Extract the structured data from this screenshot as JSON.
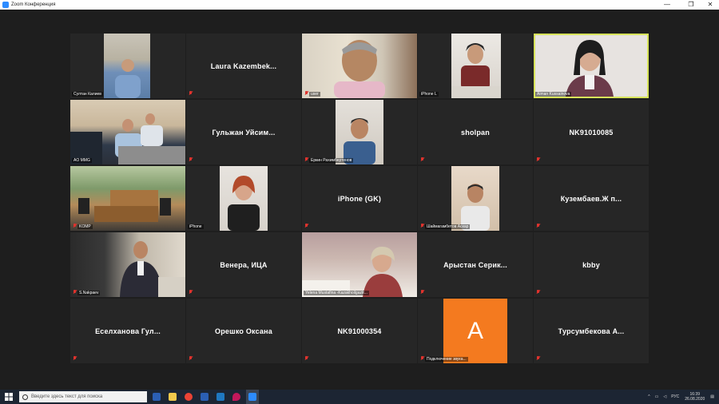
{
  "window": {
    "title": "Zoom Конференция",
    "controls": {
      "minimize": "—",
      "maximize": "❐",
      "close": "✕"
    }
  },
  "tiles": [
    {
      "name": "Султан Калиев",
      "type": "video",
      "muted": false
    },
    {
      "name": "Laura  Kazembek...",
      "type": "name",
      "muted": true
    },
    {
      "name": "user",
      "type": "video",
      "muted": true
    },
    {
      "name": "iPhone L",
      "type": "video",
      "muted": false
    },
    {
      "name": "Aiman Kussainova",
      "type": "video",
      "muted": false,
      "active": true
    },
    {
      "name": "AO MMG",
      "type": "video",
      "muted": false
    },
    {
      "name": "Гульжан  Уйсим...",
      "type": "name",
      "muted": true
    },
    {
      "name": "Еркин Рахимбертенов",
      "type": "video",
      "muted": true
    },
    {
      "name": "sholpan",
      "type": "name",
      "muted": true
    },
    {
      "name": "NK91010085",
      "type": "name",
      "muted": true
    },
    {
      "name": "KOMP",
      "type": "video",
      "muted": true
    },
    {
      "name": "iPhone",
      "type": "video",
      "muted": false
    },
    {
      "name": "iPhone (GK)",
      "type": "name",
      "muted": true
    },
    {
      "name": "Шаймагамбетов Аскар",
      "type": "video",
      "muted": true
    },
    {
      "name": "Кузембаев.Ж  п...",
      "type": "name",
      "muted": true
    },
    {
      "name": "S.Nakpaev",
      "type": "video",
      "muted": true
    },
    {
      "name": "Венера, ИЦА",
      "type": "name",
      "muted": true
    },
    {
      "name": "Yelena Mustafina -Kazakhoilgaztr...",
      "type": "video",
      "muted": false
    },
    {
      "name": "Арыстан  Серик...",
      "type": "name",
      "muted": true
    },
    {
      "name": "kbby",
      "type": "name",
      "muted": true
    },
    {
      "name": "Еселханова  Гул...",
      "type": "name",
      "muted": true
    },
    {
      "name": "Орешко Оксана",
      "type": "name",
      "muted": true
    },
    {
      "name": "NK91000354",
      "type": "name",
      "muted": true
    },
    {
      "name": "Подключение звука...",
      "type": "avatar",
      "avatar_letter": "A",
      "muted": true
    },
    {
      "name": "Турсумбекова  А...",
      "type": "name",
      "muted": true
    }
  ],
  "taskbar": {
    "search_placeholder": "Введите здесь текст для поиска",
    "language": "РУС",
    "time": "16:39",
    "date": "26.08.2020"
  },
  "colors": {
    "active_speaker_border": "#d7e35a",
    "mute_icon": "#e0332d",
    "avatar_bg": "#f47a1f",
    "zoom_blue": "#2d8cff"
  }
}
